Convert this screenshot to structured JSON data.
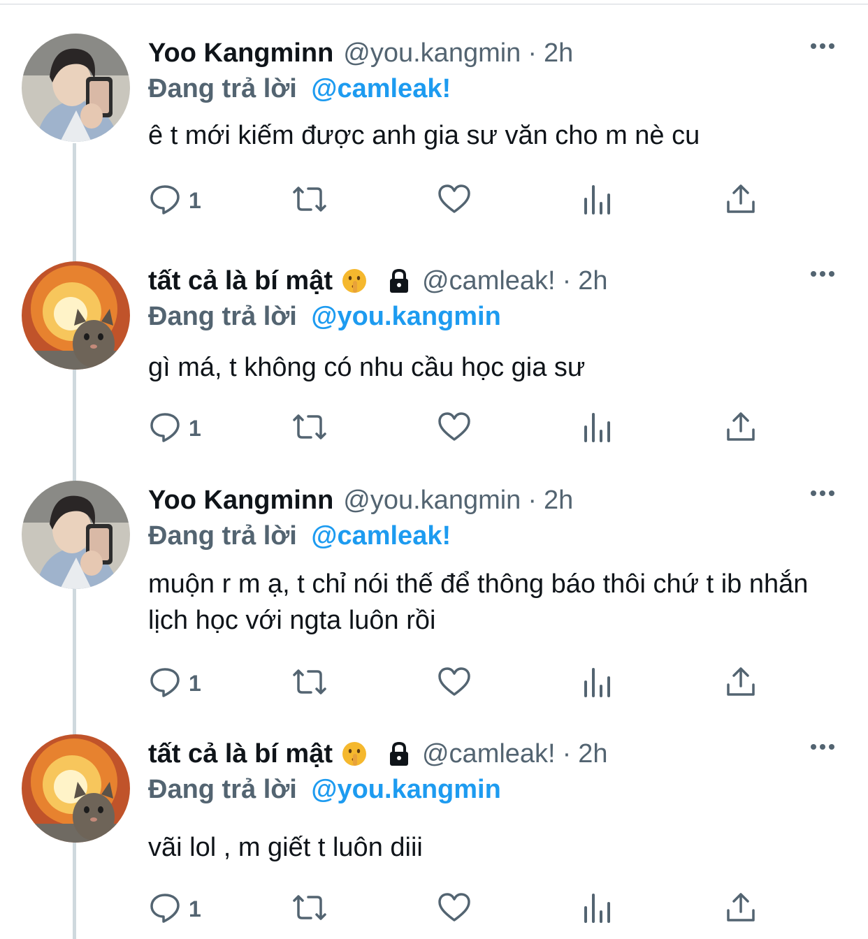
{
  "tweets": [
    {
      "name": "Yoo Kangminn",
      "handle": "@you.kangmin",
      "separator": "·",
      "time": "2h",
      "has_emoji": false,
      "locked": false,
      "avatar": "boy-selfie-avatar",
      "reply_label": "Đang trả lời",
      "reply_to": "@camleak!",
      "text": "ê t mới kiếm được anh gia sư văn cho m nè cu",
      "reply_count": "1"
    },
    {
      "name": "tất cả là bí mật",
      "handle": "@camleak!",
      "separator": "·",
      "time": "2h",
      "has_emoji": true,
      "emoji": "🤫",
      "locked": true,
      "avatar": "explosion-cat-avatar",
      "reply_label": "Đang trả lời",
      "reply_to": "@you.kangmin",
      "text": "gì má, t không có nhu cầu học gia sư",
      "reply_count": "1"
    },
    {
      "name": "Yoo Kangminn",
      "handle": "@you.kangmin",
      "separator": "·",
      "time": "2h",
      "has_emoji": false,
      "locked": false,
      "avatar": "boy-selfie-avatar",
      "reply_label": "Đang trả lời",
      "reply_to": "@camleak!",
      "text": "muộn r m ạ, t chỉ nói thế để thông báo thôi chứ t ib nhắn lịch học với ngta luôn rồi",
      "reply_count": "1"
    },
    {
      "name": "tất cả là bí mật",
      "handle": "@camleak!",
      "separator": "·",
      "time": "2h",
      "has_emoji": true,
      "emoji": "🤫",
      "locked": true,
      "avatar": "explosion-cat-avatar",
      "reply_label": "Đang trả lời",
      "reply_to": "@you.kangmin",
      "text": "vãi lol , m giết t luôn diii",
      "reply_count": "1"
    }
  ],
  "colors": {
    "accent": "#1d9bf0",
    "secondary_text": "#536471",
    "primary_text": "#0f1419",
    "thread_line": "#cfd9de"
  },
  "icons": [
    "reply-icon",
    "retweet-icon",
    "like-icon",
    "analytics-icon",
    "share-icon",
    "more-icon",
    "lock-icon"
  ]
}
